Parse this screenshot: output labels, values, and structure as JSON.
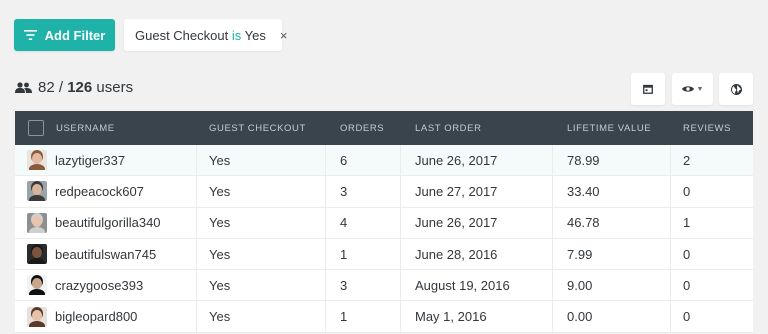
{
  "toolbar": {
    "add_filter_label": "Add Filter",
    "filter": {
      "field": "Guest Checkout",
      "operator": "is",
      "value": "Yes"
    },
    "close_glyph": "×"
  },
  "summary": {
    "filtered": "82",
    "separator": "/",
    "total": "126",
    "unit": "users"
  },
  "view_buttons": [
    {
      "icon": "calendar-icon"
    },
    {
      "icon": "eye-icon"
    },
    {
      "icon": "globe-icon"
    }
  ],
  "table": {
    "columns": [
      "USERNAME",
      "GUEST CHECKOUT",
      "ORDERS",
      "LAST ORDER",
      "LIFETIME VALUE",
      "REVIEWS"
    ],
    "rows": [
      {
        "username": "lazytiger337",
        "guest": "Yes",
        "orders": "6",
        "last_order": "June 26, 2017",
        "lifetime": "78.99",
        "reviews": "2",
        "avatar": {
          "bg": "#e9e4df",
          "skin": "#e2b9a2",
          "hair": "#8a5a3c"
        }
      },
      {
        "username": "redpeacock607",
        "guest": "Yes",
        "orders": "3",
        "last_order": "June 27, 2017",
        "lifetime": "33.40",
        "reviews": "0",
        "avatar": {
          "bg": "#9aa3a8",
          "skin": "#d8b49c",
          "hair": "#3b3b3b"
        }
      },
      {
        "username": "beautifulgorilla340",
        "guest": "Yes",
        "orders": "4",
        "last_order": "June 26, 2017",
        "lifetime": "46.78",
        "reviews": "1",
        "avatar": {
          "bg": "#8d8f90",
          "skin": "#e8c4ae",
          "hair": "#cfcfcf"
        }
      },
      {
        "username": "beautifulswan745",
        "guest": "Yes",
        "orders": "1",
        "last_order": "June 28, 2016",
        "lifetime": "7.99",
        "reviews": "0",
        "avatar": {
          "bg": "#2b2b2b",
          "skin": "#7a5440",
          "hair": "#1a1a1a"
        }
      },
      {
        "username": "crazygoose393",
        "guest": "Yes",
        "orders": "3",
        "last_order": "August 19, 2016",
        "lifetime": "9.00",
        "reviews": "0",
        "avatar": {
          "bg": "#f2f2f2",
          "skin": "#caa58e",
          "hair": "#111111"
        }
      },
      {
        "username": "bigleopard800",
        "guest": "Yes",
        "orders": "1",
        "last_order": "May 1, 2016",
        "lifetime": "0.00",
        "reviews": "0",
        "avatar": {
          "bg": "#e6e1dc",
          "skin": "#e6c2aa",
          "hair": "#5a3a2a"
        }
      }
    ]
  },
  "colors": {
    "accent": "#1fb2a8",
    "header_bg": "#3a444c"
  }
}
